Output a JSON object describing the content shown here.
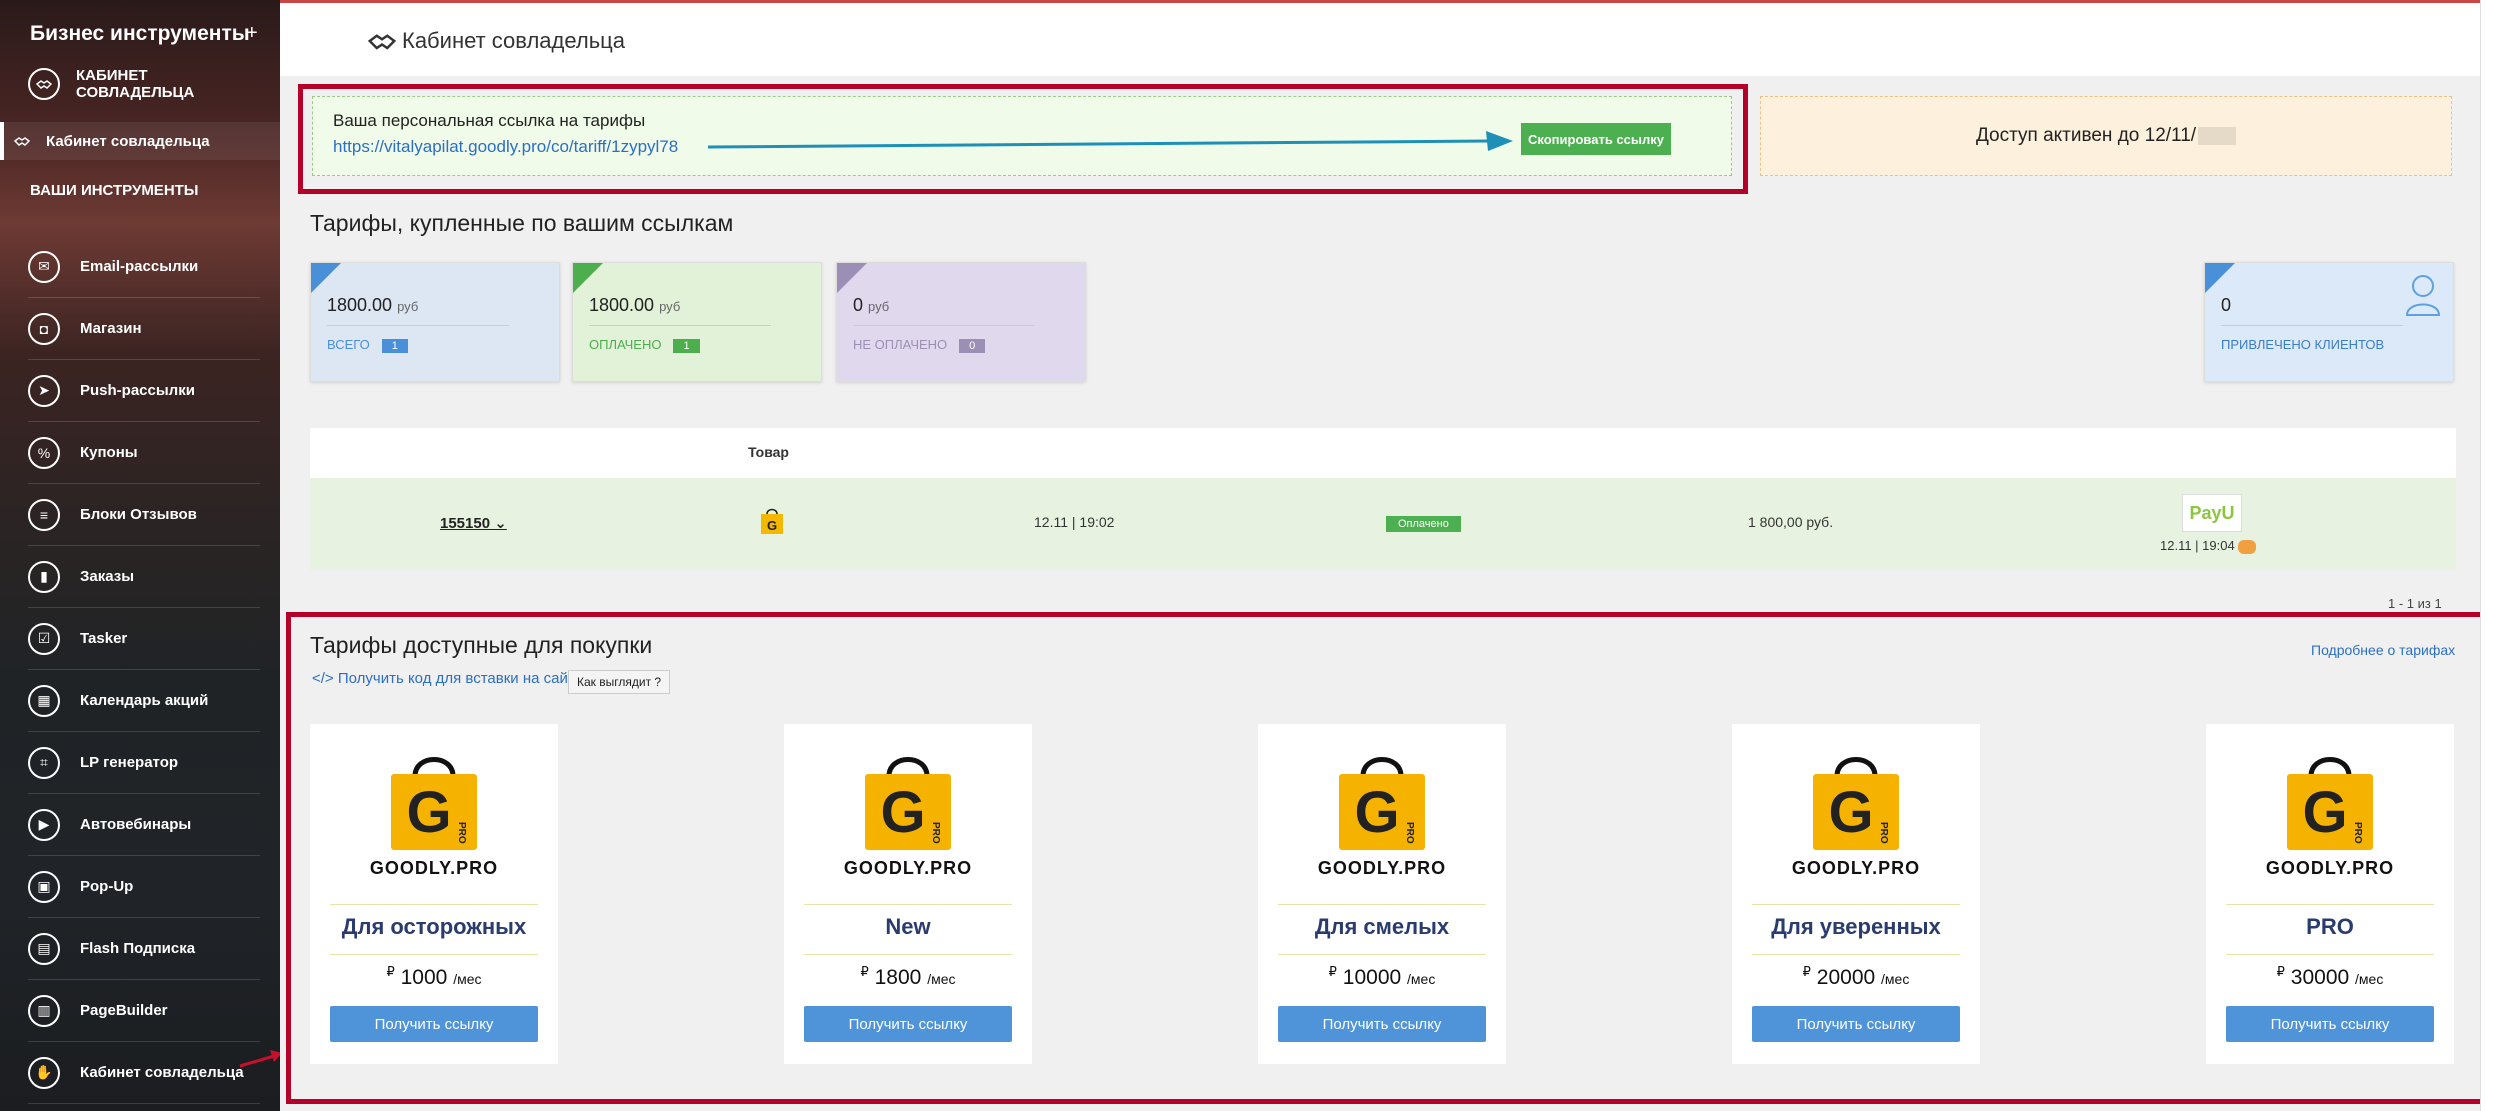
{
  "sidebar": {
    "brand": "Бизнес инструменты",
    "plus": "+",
    "section_label": "КАБИНЕТ СОВЛАДЕЛЬЦА",
    "active_item": "Кабинет совладельца",
    "tools_heading": "ВАШИ ИНСТРУМЕНТЫ",
    "items": [
      {
        "label": "Email-рассылки",
        "icon": "mail-icon"
      },
      {
        "label": "Магазин",
        "icon": "bag-icon"
      },
      {
        "label": "Push-рассылки",
        "icon": "send-icon"
      },
      {
        "label": "Купоны",
        "icon": "coupon-icon"
      },
      {
        "label": "Блоки Отзывов",
        "icon": "reviews-icon"
      },
      {
        "label": "Заказы",
        "icon": "orders-icon"
      },
      {
        "label": "Tasker",
        "icon": "checkbox-icon"
      },
      {
        "label": "Календарь акций",
        "icon": "calendar-icon"
      },
      {
        "label": "LP генератор",
        "icon": "lp-icon"
      },
      {
        "label": "Автовебинары",
        "icon": "video-icon"
      },
      {
        "label": "Pop-Up",
        "icon": "popup-icon"
      },
      {
        "label": "Flash Подписка",
        "icon": "flash-icon"
      },
      {
        "label": "PageBuilder",
        "icon": "pagebuilder-icon"
      },
      {
        "label": "Кабинет совладельца",
        "icon": "handshake-icon"
      }
    ]
  },
  "header": {
    "title": "Кабинет совладельца"
  },
  "ref_link": {
    "caption": "Ваша персональная ссылка на тарифы",
    "url": "https://vitalyapilat.goodly.pro/co/tariff/1zypyl78",
    "copy_label": "Скопировать ссылку"
  },
  "access": {
    "text": "Доступ активен до 12/11/"
  },
  "bought": {
    "title": "Тарифы, купленные по вашим ссылкам",
    "stats": [
      {
        "amount": "1800.00",
        "currency": "руб",
        "label": "ВСЕГО",
        "count": "1",
        "color": "#4a90d9"
      },
      {
        "amount": "1800.00",
        "currency": "руб",
        "label": "ОПЛАЧЕНО",
        "count": "1",
        "color": "#4cae4c"
      },
      {
        "amount": "0",
        "currency": "руб",
        "label": "НЕ ОПЛАЧЕНО",
        "count": "0",
        "color": "#9b8fb5"
      }
    ],
    "clients": {
      "amount": "0",
      "label": "ПРИВЛЕЧЕНО КЛИЕНТОВ"
    }
  },
  "table": {
    "header_product": "Товар",
    "row": {
      "order_id": "155150",
      "created": "12.11 | 19:02",
      "status": "Оплачено",
      "sum": "1 800,00 руб.",
      "payment": "PayU",
      "paid_at": "12.11 | 19:04"
    },
    "pager": "1 - 1 из 1"
  },
  "tariffs": {
    "title": "Тарифы доступные для покупки",
    "embed_link": "Получить код для вставки на сайт",
    "look_btn": "Как выглядит ?",
    "more_link": "Подробнее о тарифах",
    "brand": "GOODLY.PRO",
    "button_label": "Получить ссылку",
    "currency_symbol": "₽",
    "period": "/мес",
    "cards": [
      {
        "name": "Для осторожных",
        "price": "1000"
      },
      {
        "name": "New",
        "price": "1800"
      },
      {
        "name": "Для смелых",
        "price": "10000"
      },
      {
        "name": "Для уверенных",
        "price": "20000"
      },
      {
        "name": "PRO",
        "price": "30000"
      }
    ]
  },
  "colors": {
    "frame": "#b5002a",
    "green": "#4caf50",
    "blue_btn": "#4f94d9",
    "accent_link": "#2b6fc4"
  }
}
